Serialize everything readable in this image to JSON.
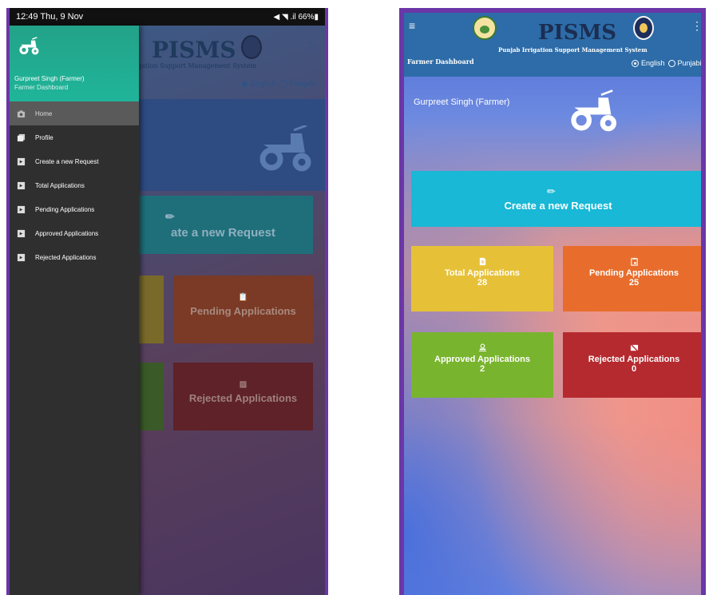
{
  "left_screen": {
    "statusbar": {
      "time_date": "12:49  Thu, 9 Nov",
      "indicators": "◀ ◥ .il 66%▮"
    },
    "background_app": {
      "title": "PISMS",
      "subtitle": "gation Support Management System",
      "lang_text": "◉ English ◯ Punjabi",
      "request_label": "ate a new Request",
      "pending_label": "Pending Applications",
      "rejected_label": "Rejected Applications"
    },
    "drawer": {
      "user_name": "Gurpreet Singh (Farmer)",
      "role": "Farmer Dashboard",
      "items": [
        {
          "label": "Home",
          "icon": "camera-icon"
        },
        {
          "label": "Profile",
          "icon": "gallery-icon"
        },
        {
          "label": "Create a new Request",
          "icon": "slideshow-icon"
        },
        {
          "label": "Total Applications",
          "icon": "slideshow-icon"
        },
        {
          "label": "Pending Applications",
          "icon": "slideshow-icon"
        },
        {
          "label": "Approved Applications",
          "icon": "slideshow-icon"
        },
        {
          "label": "Rejected Applications",
          "icon": "slideshow-icon"
        }
      ]
    }
  },
  "right_screen": {
    "appbar": {
      "menu_icon": "≡",
      "title": "PISMS",
      "subtitle": "Punjab Irrigation Support Management System",
      "dashboard_label": "Farmer Dashboard",
      "overflow_icon": "⋮",
      "lang_english": "English",
      "lang_punjabi": "Punjabi"
    },
    "user_name": "Gurpreet Singh (Farmer)",
    "request_button": {
      "label": "Create a new Request",
      "icon": "✏"
    },
    "tiles": {
      "total": {
        "label": "Total Applications",
        "count": "28",
        "color": "#e6c138"
      },
      "pending": {
        "label": "Pending Applications",
        "count": "25",
        "color": "#e86d2c"
      },
      "approved": {
        "label": "Approved Applications",
        "count": "2",
        "color": "#79b42e"
      },
      "rejected": {
        "label": "Rejected Applications",
        "count": "0",
        "color": "#b52a2f"
      }
    }
  }
}
